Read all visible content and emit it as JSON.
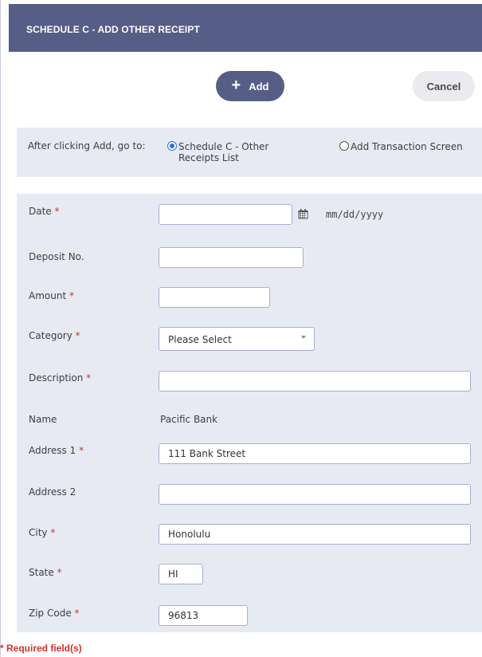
{
  "header": {
    "title": "SCHEDULE C - ADD OTHER RECEIPT"
  },
  "toolbar": {
    "add_label": "Add",
    "add_icon": "plus-icon",
    "cancel_label": "Cancel"
  },
  "goto": {
    "label": "After clicking Add, go to:",
    "options": [
      {
        "label": "Schedule C - Other Receipts List",
        "selected": true
      },
      {
        "label": "Add Transaction Screen",
        "selected": false
      }
    ]
  },
  "required_marker": "*",
  "fields": {
    "date": {
      "label": "Date",
      "value": "",
      "hint": "mm/dd/yyyy",
      "icon": "calendar-icon"
    },
    "deposit_no": {
      "label": "Deposit No.",
      "value": ""
    },
    "amount": {
      "label": "Amount",
      "value": ""
    },
    "category": {
      "label": "Category",
      "value": "Please Select"
    },
    "description": {
      "label": "Description",
      "value": ""
    },
    "name": {
      "label": "Name",
      "value": "Pacific Bank"
    },
    "address1": {
      "label": "Address 1",
      "value": "111 Bank Street"
    },
    "address2": {
      "label": "Address 2",
      "value": ""
    },
    "city": {
      "label": "City",
      "value": "Honolulu"
    },
    "state": {
      "label": "State",
      "value": "HI"
    },
    "zip": {
      "label": "Zip Code",
      "value": "96813"
    }
  },
  "footer": {
    "required_note": "* Required field(s)"
  },
  "colors": {
    "header_bg": "#565d87",
    "panel_bg": "#e8eaf3",
    "required": "#d22f2f",
    "radio": "#2a6fd6"
  }
}
